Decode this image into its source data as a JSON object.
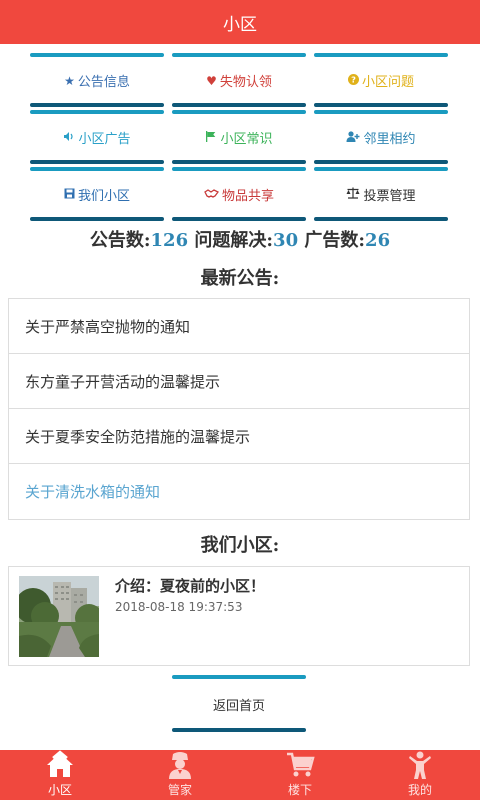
{
  "header": {
    "title": "小区"
  },
  "menu": [
    {
      "label": "公告信息",
      "icon": "star-icon",
      "color": "#3a6fb0",
      "glyph": "★"
    },
    {
      "label": "失物认领",
      "icon": "heart-icon",
      "color": "#d0403a",
      "glyph": "♥"
    },
    {
      "label": "小区问题",
      "icon": "question-circle-icon",
      "color": "#e0b11a",
      "glyph": "?"
    },
    {
      "label": "小区广告",
      "icon": "speaker-icon",
      "color": "#2aa0c8",
      "glyph": "🔈"
    },
    {
      "label": "小区常识",
      "icon": "flag-icon",
      "color": "#3cb35a",
      "glyph": "⚑"
    },
    {
      "label": "邻里相约",
      "icon": "user-plus-icon",
      "color": "#2f86b3",
      "glyph": "👤"
    },
    {
      "label": "我们小区",
      "icon": "save-icon",
      "color": "#2f6fb0",
      "glyph": "▣"
    },
    {
      "label": "物品共享",
      "icon": "handshake-icon",
      "color": "#c83a3a",
      "glyph": "∞"
    },
    {
      "label": "投票管理",
      "icon": "balance-scale-icon",
      "color": "#333333",
      "glyph": "⚖"
    }
  ],
  "stats": {
    "notice_label": "公告数:",
    "notice_count": "126",
    "solved_label": "问题解决:",
    "solved_count": "30",
    "ad_label": "广告数:",
    "ad_count": "26"
  },
  "latest_notices": {
    "title": "最新公告:",
    "items": [
      "关于严禁高空抛物的通知",
      "东方童子开营活动的温馨提示",
      "关于夏季安全防范措施的温馨提示",
      "关于清洗水箱的通知"
    ]
  },
  "community": {
    "title": "我们小区:",
    "card_title": "介绍：夏夜前的小区！",
    "card_date": "2018-08-18 19:37:53"
  },
  "back_button": "返回首页",
  "tabs": [
    {
      "label": "小区",
      "icon": "home-icon"
    },
    {
      "label": "管家",
      "icon": "butler-icon"
    },
    {
      "label": "楼下",
      "icon": "cart-icon"
    },
    {
      "label": "我的",
      "icon": "person-icon"
    }
  ]
}
